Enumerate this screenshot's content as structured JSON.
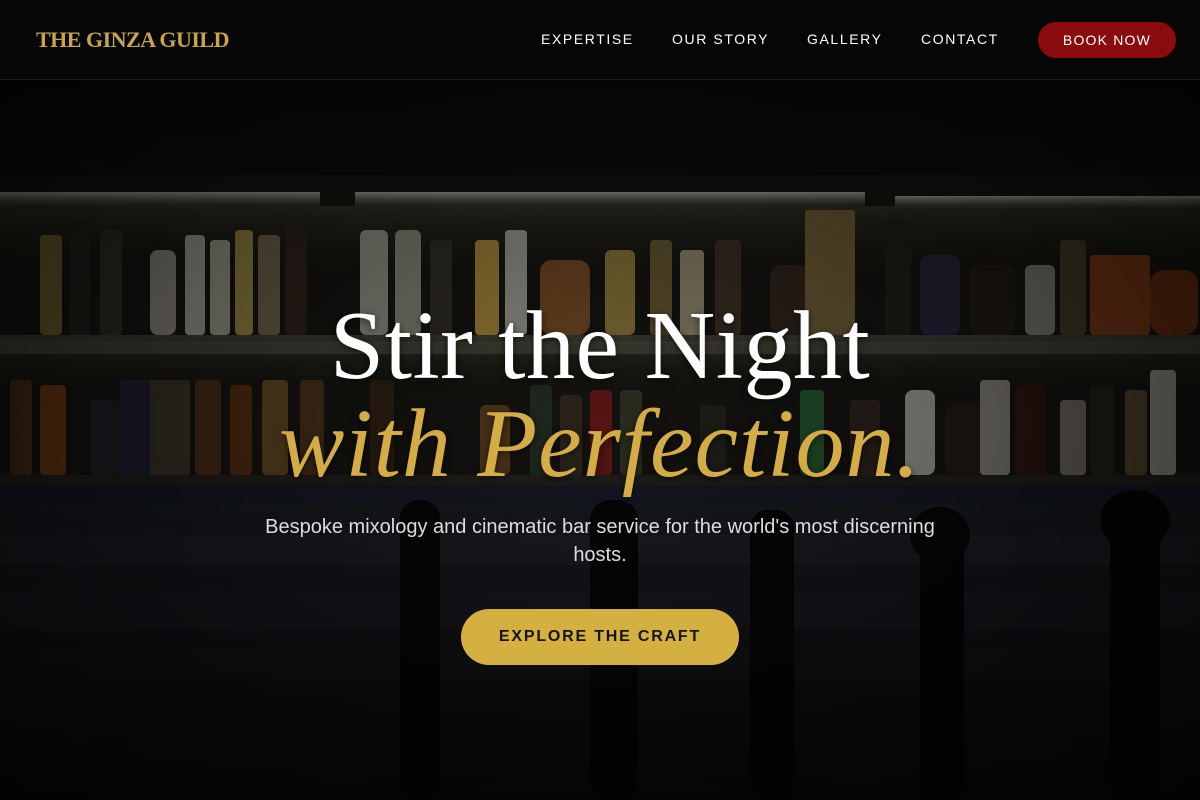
{
  "brand": {
    "name": "THE GINZA GUILD",
    "accent_color": "#c9a44a"
  },
  "nav": {
    "links": [
      "EXPERTISE",
      "OUR STORY",
      "GALLERY",
      "CONTACT"
    ],
    "book_label": "BOOK NOW",
    "book_color": "#8a0b0b"
  },
  "hero": {
    "title_line1": "Stir the Night",
    "title_line2": "with Perfection.",
    "subtitle": "Bespoke mixology and cinematic bar service for the world's most discerning hosts.",
    "cta_label": "EXPLORE THE CRAFT",
    "cta_color": "#d4b040",
    "background": "dimly lit bar shelves with liquor bottles"
  }
}
